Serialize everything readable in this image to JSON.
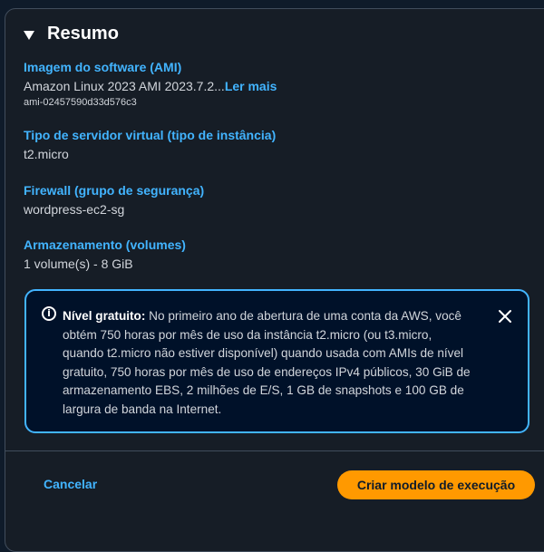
{
  "summary": {
    "title": "Resumo",
    "ami": {
      "label": "Imagem do software (AMI)",
      "value": "Amazon Linux 2023 AMI 2023.7.2...",
      "more_link": "Ler mais",
      "id": "ami-02457590d33d576c3"
    },
    "instance_type": {
      "label": "Tipo de servidor virtual (tipo de instância)",
      "value": "t2.micro"
    },
    "firewall": {
      "label": "Firewall (grupo de segurança)",
      "value": "wordpress-ec2-sg"
    },
    "storage": {
      "label": "Armazenamento (volumes)",
      "value": "1 volume(s) - 8 GiB"
    }
  },
  "free_tier": {
    "heading": "Nível gratuito:",
    "text": "No primeiro ano de abertura de uma conta da AWS, você obtém 750 horas por mês de uso da instância t2.micro (ou t3.micro, quando t2.micro não estiver disponível) quando usada com AMIs de nível gratuito, 750 horas por mês de uso de endereços IPv4 públicos, 30 GiB de armazenamento EBS, 2 milhões de E/S, 1 GB de snapshots e 100 GB de largura de banda na Internet."
  },
  "actions": {
    "cancel": "Cancelar",
    "primary": "Criar modelo de execução"
  },
  "colors": {
    "accent": "#42b4ff",
    "primary_button": "#ff9900",
    "panel_bg": "#161d26",
    "info_bg": "#001129"
  },
  "icons": {
    "caret": "caret-down-icon",
    "info": "info-icon",
    "close": "close-icon"
  }
}
